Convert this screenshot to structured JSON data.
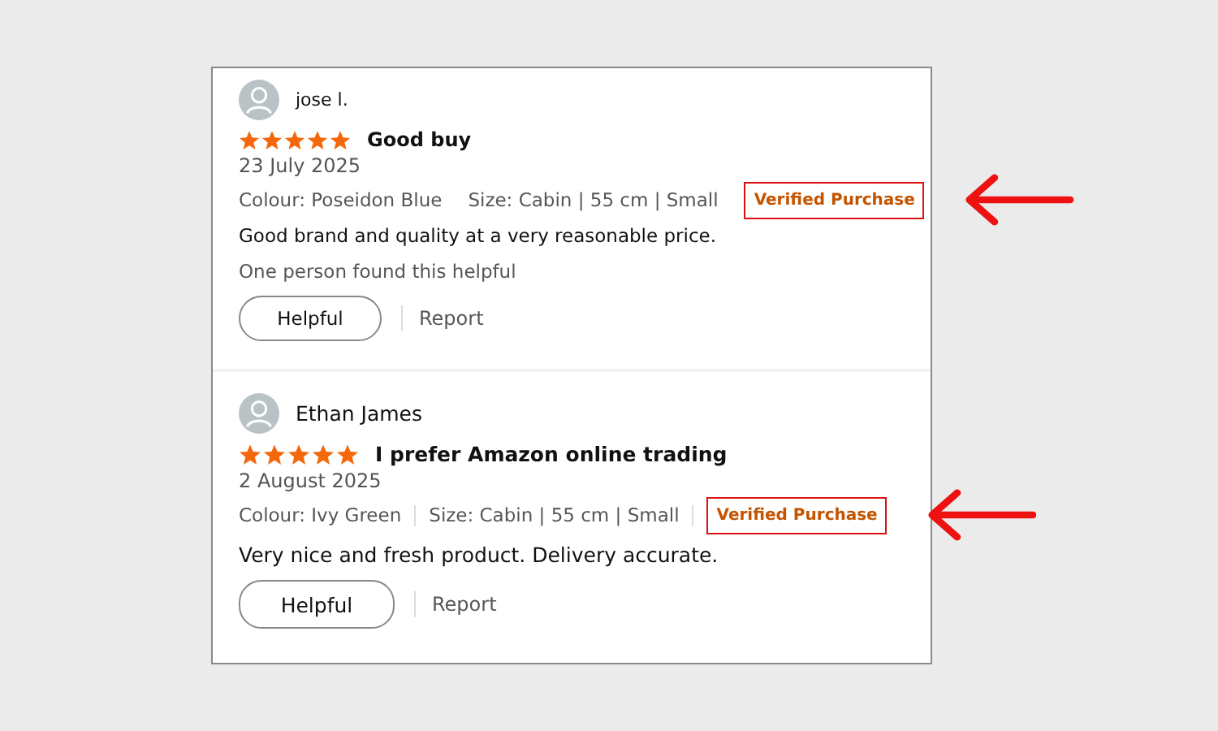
{
  "reviews": [
    {
      "reviewer": "jose l.",
      "stars": 5,
      "title": "Good buy",
      "date": "23 July 2025",
      "colour": "Colour: Poseidon Blue",
      "size": "Size: Cabin | 55 cm | Small",
      "badge": "Verified Purchase",
      "body": "Good brand and quality at a very reasonable price.",
      "helpful_count": "One person found this helpful",
      "helpful_button": "Helpful",
      "report": "Report",
      "highlighted": true
    },
    {
      "reviewer": "Ethan James",
      "stars": 5,
      "title": "I prefer Amazon online trading",
      "date": "2 August 2025",
      "colour": "Colour: Ivy Green",
      "size": "Size: Cabin | 55 cm | Small",
      "badge": "Verified Purchase",
      "body": "Very nice and fresh product. Delivery accurate.",
      "helpful_button": "Helpful",
      "report": "Report",
      "highlighted": true
    }
  ]
}
